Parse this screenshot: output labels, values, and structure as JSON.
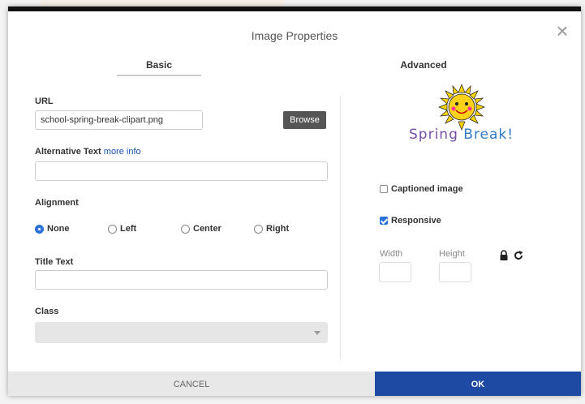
{
  "dialog": {
    "title": "Image Properties",
    "tabs": [
      {
        "label": "Basic",
        "active": true
      },
      {
        "label": "Advanced",
        "active": false
      }
    ]
  },
  "basic": {
    "url_label": "URL",
    "url_value": "school-spring-break-clipart.png",
    "browse_label": "Browse",
    "alt_label": "Alternative Text",
    "alt_link": "more info",
    "alt_value": "",
    "alignment_label": "Alignment",
    "alignment_options": [
      "None",
      "Left",
      "Center",
      "Right"
    ],
    "alignment_selected": "None",
    "title_label": "Title Text",
    "title_value": "",
    "class_label": "Class",
    "class_value": ""
  },
  "preview": {
    "image_alt": "Spring Break clipart",
    "caption_word1": "Spring",
    "caption_word2": "Break!"
  },
  "options": {
    "captioned_label": "Captioned image",
    "captioned_checked": false,
    "responsive_label": "Responsive",
    "responsive_checked": true,
    "width_label": "Width",
    "height_label": "Height",
    "width_value": "",
    "height_value": ""
  },
  "footer": {
    "cancel_label": "CANCEL",
    "ok_label": "OK"
  },
  "colors": {
    "accent": "#2a72d8",
    "ok_button": "#1f4aa3",
    "browse_button": "#555555",
    "link": "#1a53b8"
  }
}
